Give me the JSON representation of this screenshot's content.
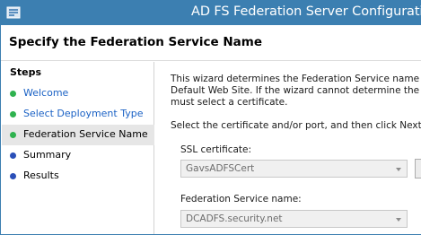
{
  "window": {
    "title": "AD FS Federation Server Configuration"
  },
  "header": {
    "title": "Specify the Federation Service Name"
  },
  "sidebar": {
    "heading": "Steps",
    "items": [
      {
        "label": "Welcome",
        "status": "completed",
        "dot_color": "#2fb24f"
      },
      {
        "label": "Select Deployment Type",
        "status": "completed",
        "dot_color": "#2fb24f"
      },
      {
        "label": "Federation Service Name",
        "status": "current",
        "dot_color": "#2fb24f"
      },
      {
        "label": "Summary",
        "status": "pending",
        "dot_color": "#2a4fb8"
      },
      {
        "label": "Results",
        "status": "pending",
        "dot_color": "#2a4fb8"
      }
    ]
  },
  "main": {
    "description_lines": [
      "This wizard determines the Federation Service name from th",
      "Default Web Site.  If the wizard cannot determine the Fede",
      "must select a certificate."
    ],
    "instruction": "Select the certificate and/or port, and then click Next.",
    "ssl_certificate": {
      "label": "SSL certificate:",
      "value": "GavsADFSCert"
    },
    "federation_service_name": {
      "label": "Federation Service name:",
      "value": "DCADFS.security.net"
    }
  },
  "colors": {
    "titlebar": "#3c7fb1",
    "link": "#1b62c5",
    "completed_dot": "#2fb24f",
    "pending_dot": "#2a4fb8",
    "selected_step_bg": "#e6e6e6"
  }
}
